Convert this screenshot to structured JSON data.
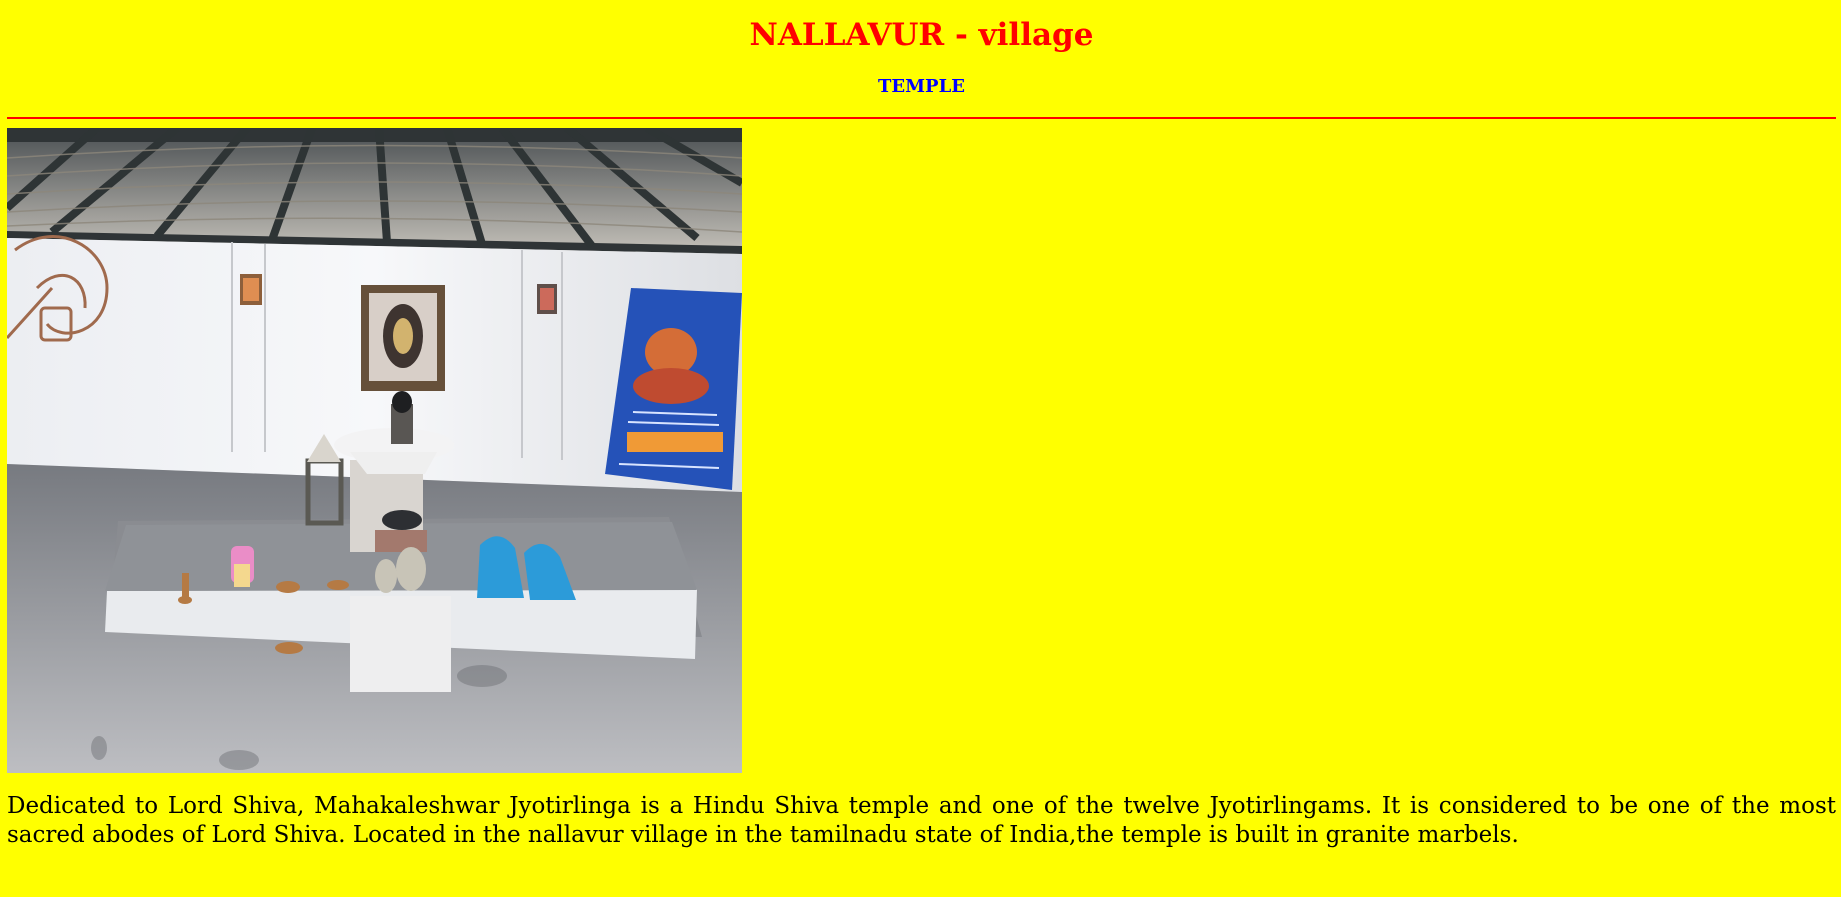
{
  "page": {
    "title": "NALLAVUR - village",
    "subtitle": "TEMPLE",
    "description": "Dedicated to Lord Shiva, Mahakaleshwar Jyotirlinga is a Hindu Shiva temple and one of the twelve Jyotirlingams. It is considered to be one of the most sacred abodes of Lord Shiva. Located in the nallavur village in the tamilnadu state of India,the temple is built in granite marbels."
  },
  "colors": {
    "background": "#ffff00",
    "title": "#ff0000",
    "subtitle": "#0000ff",
    "divider": "#ff0000",
    "body_text": "#000000"
  },
  "photo": {
    "subject": "temple interior with shiva lingam shrine"
  }
}
